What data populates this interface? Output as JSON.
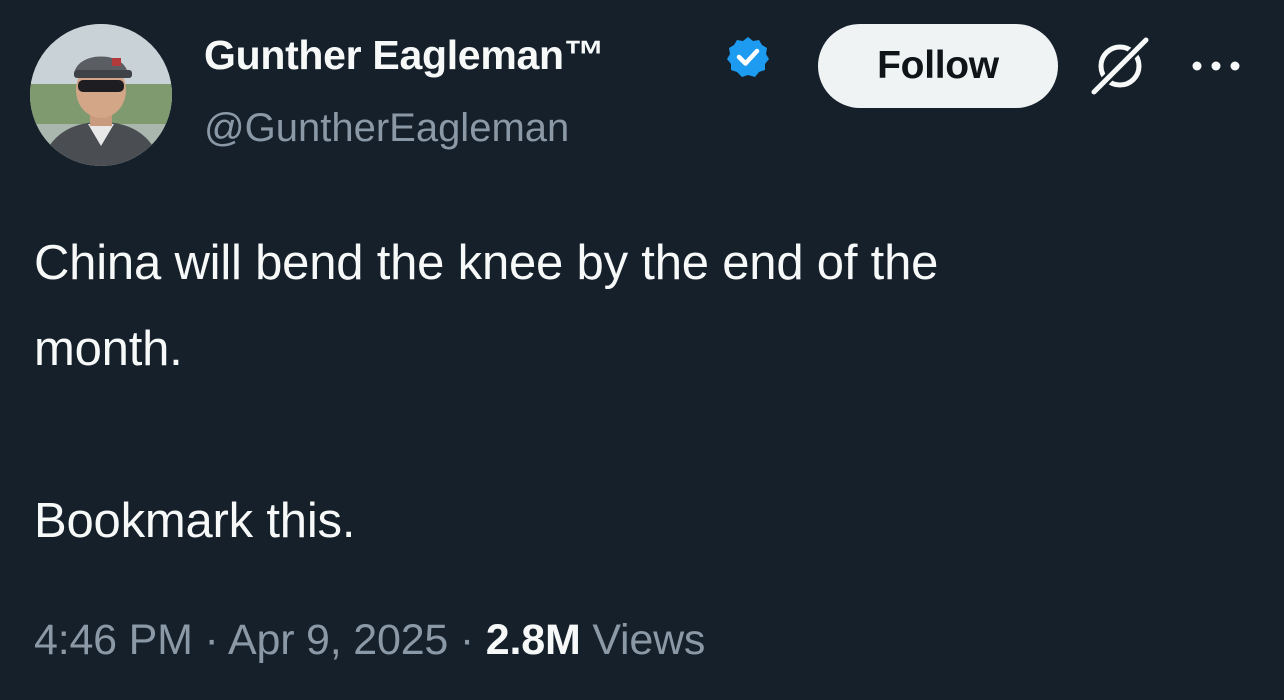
{
  "author": {
    "display_name": "Gunther Eagleman™",
    "handle": "@GuntherEagleman",
    "verified": true
  },
  "header": {
    "follow_label": "Follow",
    "icons": [
      "verified-badge-icon",
      "grok-icon",
      "more-options-icon"
    ]
  },
  "tweet": {
    "line1": "China will bend the knee by the end of the",
    "line2": "month.",
    "line3": "Bookmark this."
  },
  "meta": {
    "time": "4:46 PM",
    "separator": "·",
    "date": "Apr 9, 2025",
    "views_count": "2.8M",
    "views_label": "Views"
  },
  "colors": {
    "background": "#15202b",
    "primary_text": "#f7f9f9",
    "secondary_text": "#8b98a5",
    "verified_blue": "#1d9bf0",
    "follow_button_bg": "#eff3f4"
  }
}
